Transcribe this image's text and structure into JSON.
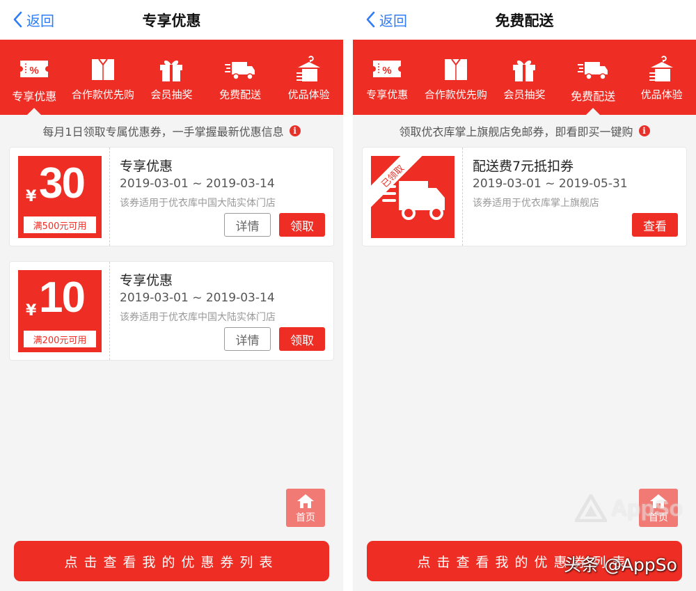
{
  "colors": {
    "brand_red": "#ee2e24",
    "link_blue": "#2f7cf6",
    "background": "#f4f4f4"
  },
  "tabs": [
    {
      "label": "专享优惠",
      "icon": "coupon-ticket-icon"
    },
    {
      "label": "合作款优先购",
      "icon": "shirt-icon"
    },
    {
      "label": "会员抽奖",
      "icon": "gift-box-icon"
    },
    {
      "label": "免费配送",
      "icon": "delivery-truck-icon"
    },
    {
      "label": "优品体验",
      "icon": "clothes-hanger-icon"
    }
  ],
  "left": {
    "back_label": "返回",
    "title": "专享优惠",
    "subtitle": "每月1日领取专属优惠券，一手掌握最新优惠信息",
    "coupons": [
      {
        "currency": "¥",
        "amount": "30",
        "condition": "满500元可用",
        "title": "专享优惠",
        "dates": "2019-03-01 ~ 2019-03-14",
        "note": "该券适用于优衣库中国大陆实体门店",
        "detail_label": "详情",
        "claim_label": "领取"
      },
      {
        "currency": "¥",
        "amount": "10",
        "condition": "满200元可用",
        "title": "专享优惠",
        "dates": "2019-03-01 ~ 2019-03-14",
        "note": "该券适用于优衣库中国大陆实体门店",
        "detail_label": "详情",
        "claim_label": "领取"
      }
    ],
    "home_label": "首页",
    "bottom_button": "点击查看我的优惠券列表"
  },
  "right": {
    "back_label": "返回",
    "title": "免费配送",
    "subtitle": "领取优衣库掌上旗舰店免邮券，即看即买一键购",
    "coupon": {
      "ribbon": "已领取",
      "title": "配送费7元抵扣券",
      "dates": "2019-03-01 ~ 2019-05-31",
      "note": "该券适用于优衣库掌上旗舰店",
      "view_label": "查看"
    },
    "home_label": "首页",
    "bottom_button": "点击查看我的优惠券列表"
  },
  "watermark": {
    "logo_text": "AppSo",
    "caption": "头条 @AppSo"
  }
}
